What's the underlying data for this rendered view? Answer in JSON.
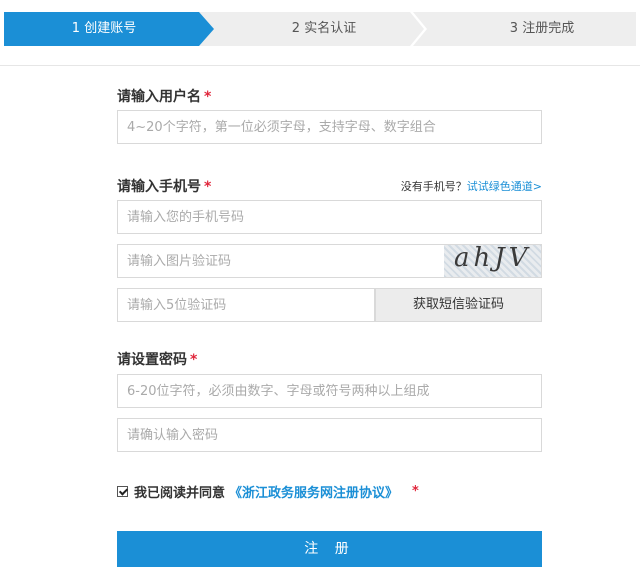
{
  "steps": [
    {
      "label": "1 创建账号",
      "active": true
    },
    {
      "label": "2 实名认证",
      "active": false
    },
    {
      "label": "3 注册完成",
      "active": false
    }
  ],
  "username": {
    "label": "请输入用户名",
    "required_mark": "*",
    "placeholder": "4~20个字符，第一位必须字母，支持字母、数字组合"
  },
  "phone": {
    "label": "请输入手机号",
    "required_mark": "*",
    "hint_text": "没有手机号？",
    "hint_link": "试试绿色通道>",
    "placeholder": "请输入您的手机号码"
  },
  "image_captcha": {
    "placeholder": "请输入图片验证码",
    "captcha_text": "ahJV"
  },
  "sms_code": {
    "placeholder": "请输入5位验证码",
    "button_label": "获取短信验证码"
  },
  "password": {
    "label": "请设置密码",
    "required_mark": "*",
    "placeholder": "6-20位字符，必须由数字、字母或符号两种以上组成",
    "confirm_placeholder": "请确认输入密码"
  },
  "agreement": {
    "checked": true,
    "text": "我已阅读并同意",
    "link": "《浙江政务服务网注册协议》",
    "required_mark": "*"
  },
  "submit_label": "注 册",
  "colors": {
    "accent": "#1b8fd6",
    "required": "#e0263b"
  }
}
